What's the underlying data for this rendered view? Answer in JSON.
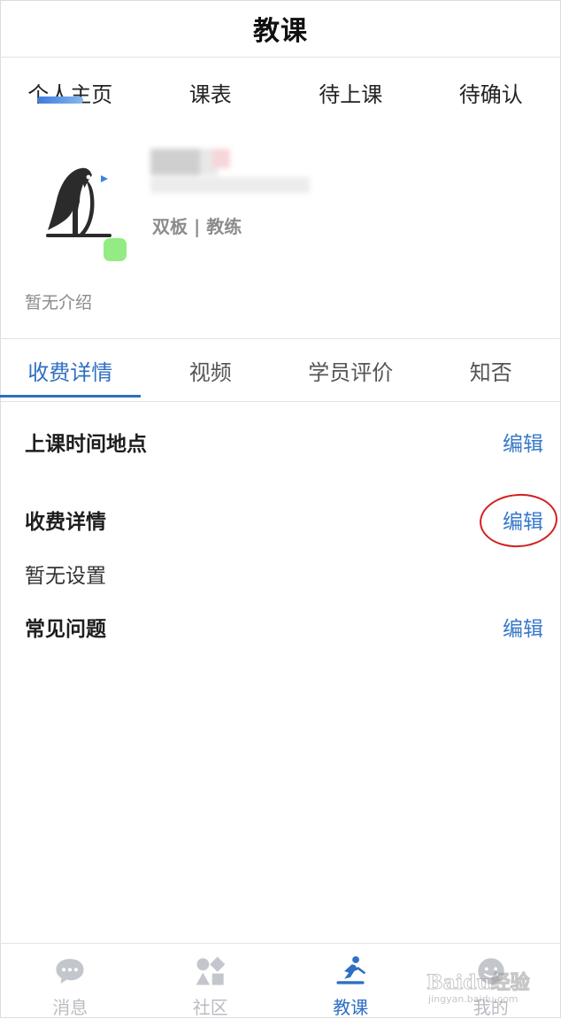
{
  "header": {
    "title": "教课"
  },
  "top_tabs": [
    {
      "label": "个人主页",
      "active": true
    },
    {
      "label": "课表",
      "active": false
    },
    {
      "label": "待上课",
      "active": false
    },
    {
      "label": "待确认",
      "active": false
    }
  ],
  "profile": {
    "avatar_icon": "penguin-logo-icon",
    "status_color": "#92ec83",
    "roles": "双板 | 教练",
    "intro": "暂无介绍"
  },
  "section_tabs": [
    {
      "label": "收费详情",
      "active": true
    },
    {
      "label": "视频",
      "active": false
    },
    {
      "label": "学员评价",
      "active": false
    },
    {
      "label": "知否",
      "active": false
    }
  ],
  "content": {
    "schedule": {
      "title": "上课时间地点",
      "edit": "编辑"
    },
    "fees": {
      "title": "收费详情",
      "edit": "编辑",
      "empty": "暂无设置"
    },
    "faq": {
      "title": "常见问题",
      "edit": "编辑"
    }
  },
  "bottom_nav": [
    {
      "label": "消息",
      "icon": "chat-bubble-icon",
      "active": false
    },
    {
      "label": "社区",
      "icon": "shapes-icon",
      "active": false
    },
    {
      "label": "教课",
      "icon": "skier-icon",
      "active": true
    },
    {
      "label": "我的",
      "icon": "profile-icon",
      "active": false
    }
  ],
  "watermark": {
    "main": "Baidu经验",
    "sub": "jingyan.baidu.com"
  },
  "colors": {
    "accent": "#2f6fc4",
    "link": "#3878c8",
    "annotation": "#d42020",
    "inactive_nav": "#b9bcc2"
  }
}
